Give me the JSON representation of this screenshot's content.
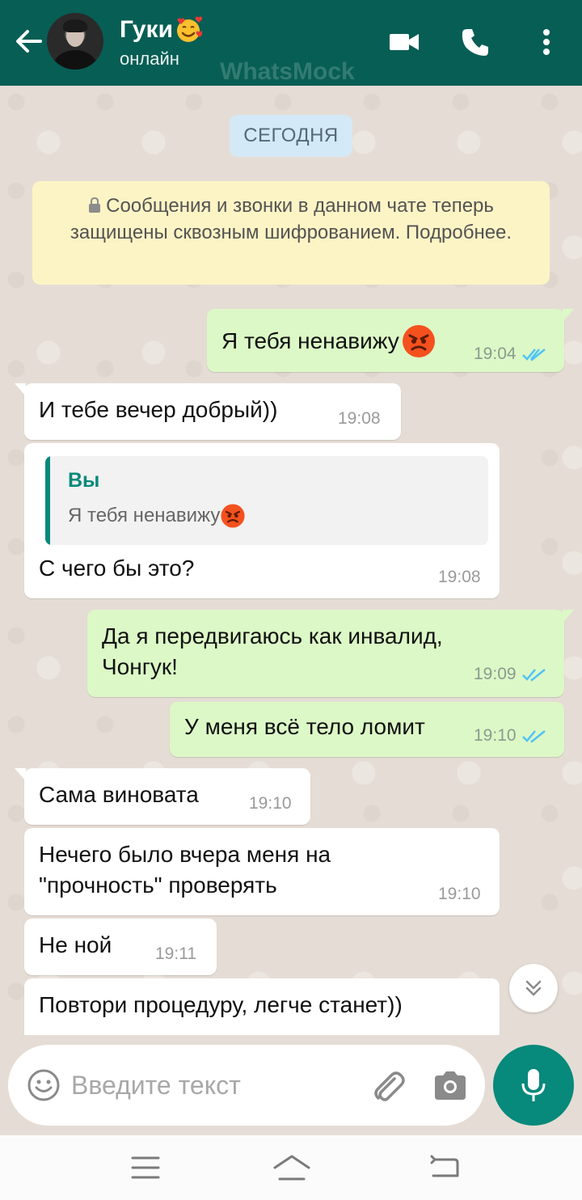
{
  "header": {
    "contact_name": "Гуки",
    "contact_status": "онлайн",
    "watermark": "WhatsMock",
    "icons": [
      "back-arrow-icon",
      "video-call-icon",
      "phone-icon",
      "more-vert-icon"
    ]
  },
  "chat": {
    "date_chip": "СЕГОДНЯ",
    "system_message": "Сообщения и звонки в данном чате теперь защищены сквозным шифрованием. Подробнее.",
    "messages": [
      {
        "dir": "out",
        "text": "Я тебя ненавижу",
        "time": "19:04",
        "status": "read"
      },
      {
        "dir": "in",
        "text": "И тебе вечер добрый))",
        "time": "19:08"
      },
      {
        "dir": "in",
        "quote_author": "Вы",
        "quote_text": "Я тебя ненавижу",
        "text": "С чего бы это?",
        "time": "19:08"
      },
      {
        "dir": "out",
        "text_line1": "Да я передвигаюсь как инвалид,",
        "text_line2": "Чонгук!",
        "time": "19:09",
        "status": "read"
      },
      {
        "dir": "out",
        "text": "У меня всё тело ломит",
        "time": "19:10",
        "status": "read"
      },
      {
        "dir": "in",
        "text": "Сама виновата",
        "time": "19:10"
      },
      {
        "dir": "in",
        "text_line1": "Нечего было вчера меня на",
        "text_line2": "\"прочность\" проверять",
        "time": "19:10"
      },
      {
        "dir": "in",
        "text": "Не ной",
        "time": "19:11"
      },
      {
        "dir": "in",
        "text": "Повтори процедуру, легче станет))"
      }
    ]
  },
  "input": {
    "placeholder": "Введите текст",
    "value": ""
  },
  "colors": {
    "header": "#075e54",
    "accent": "#07897b",
    "outgoing_bubble": "#dcf8c6",
    "incoming_bubble": "#ffffff",
    "read_ticks": "#4fc3f7",
    "chat_bg": "#e5ddd5"
  }
}
